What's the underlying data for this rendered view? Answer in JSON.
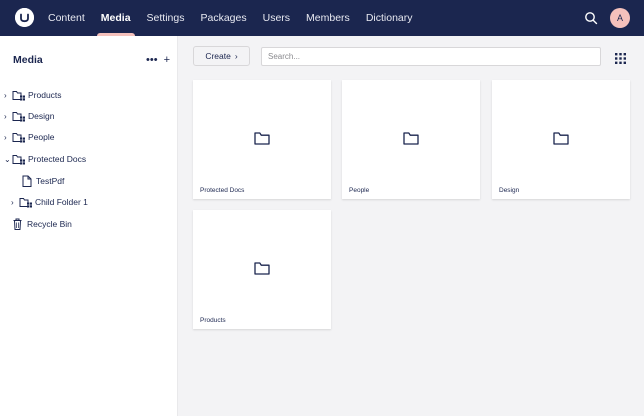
{
  "nav": {
    "items": [
      "Content",
      "Media",
      "Settings",
      "Packages",
      "Users",
      "Members",
      "Dictionary"
    ],
    "active": "Media"
  },
  "user": {
    "initial": "A"
  },
  "sidebar": {
    "title": "Media",
    "more_label": "•••",
    "add_label": "+",
    "items": [
      {
        "label": "Products",
        "icon": "folder-icon",
        "expandable": true,
        "expanded": false
      },
      {
        "label": "Design",
        "icon": "folder-icon",
        "expandable": true,
        "expanded": false
      },
      {
        "label": "People",
        "icon": "folder-icon",
        "expandable": true,
        "expanded": false
      },
      {
        "label": "Protected Docs",
        "icon": "folder-icon",
        "expandable": true,
        "expanded": true
      },
      {
        "label": "TestPdf",
        "icon": "document-icon",
        "expandable": false
      },
      {
        "label": "Child Folder 1",
        "icon": "folder-icon",
        "expandable": true,
        "expanded": false
      },
      {
        "label": "Recycle Bin",
        "icon": "trash-icon",
        "expandable": false
      }
    ]
  },
  "toolbar": {
    "create_label": "Create",
    "create_chevron": "›",
    "search_placeholder": "Search..."
  },
  "cards": [
    {
      "label": "Protected Docs",
      "icon": "folder-icon"
    },
    {
      "label": "People",
      "icon": "folder-icon"
    },
    {
      "label": "Design",
      "icon": "folder-icon"
    },
    {
      "label": "Products",
      "icon": "folder-icon"
    }
  ],
  "colors": {
    "header_bg": "#1b264f",
    "accent": "#f5c1bc",
    "text": "#1b264f"
  }
}
